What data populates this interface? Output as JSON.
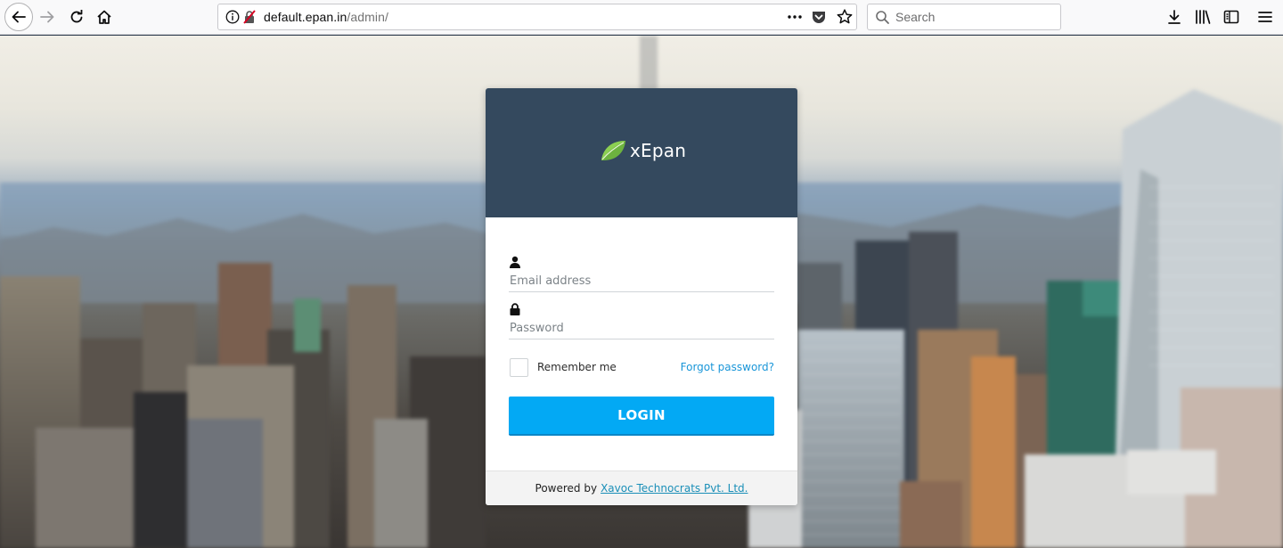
{
  "browser": {
    "url_host": "default.epan.in",
    "url_path": "/admin/",
    "search_placeholder": "Search"
  },
  "login": {
    "brand_name": "xEpan",
    "email_placeholder": "Email address",
    "password_placeholder": "Password",
    "remember_label": "Remember me",
    "forgot_label": "Forgot password?",
    "login_label": "LOGIN",
    "footer_prefix": "Powered by",
    "footer_link": "Xavoc Technocrats Pvt. Ltd."
  },
  "colors": {
    "header_bg": "#34495e",
    "login_button": "#03a9f4",
    "link": "#1a96d8",
    "leaf": "#6db33f"
  },
  "icons": [
    "back-arrow-icon",
    "forward-arrow-icon",
    "reload-icon",
    "home-icon",
    "info-icon",
    "insecure-lock-icon",
    "more-dots-icon",
    "pocket-icon",
    "star-icon",
    "search-icon",
    "download-icon",
    "library-icon",
    "sidebar-icon",
    "menu-icon",
    "leaf-icon",
    "user-icon",
    "lock-icon"
  ]
}
